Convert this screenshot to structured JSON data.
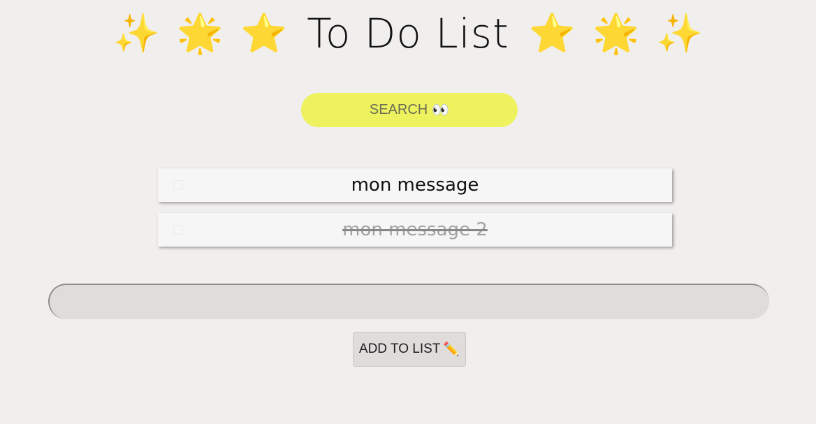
{
  "header": {
    "title": "To Do List",
    "emojis_left": [
      "✨",
      "🌟",
      "⭐"
    ],
    "emojis_right": [
      "⭐",
      "🌟",
      "✨"
    ]
  },
  "search": {
    "label": "SEARCH",
    "icon": "👀"
  },
  "todo_items": [
    {
      "text": "mon message",
      "done": false
    },
    {
      "text": "mon message 2",
      "done": true
    }
  ],
  "new_item": {
    "value": "",
    "placeholder": ""
  },
  "add_button": {
    "label": "ADD TO LIST",
    "icon": "✏️"
  },
  "colors": {
    "background": "#f1efee",
    "search_button": "#edf25e",
    "input_background": "#dfdcdb",
    "done_text": "#a3a3a3"
  }
}
